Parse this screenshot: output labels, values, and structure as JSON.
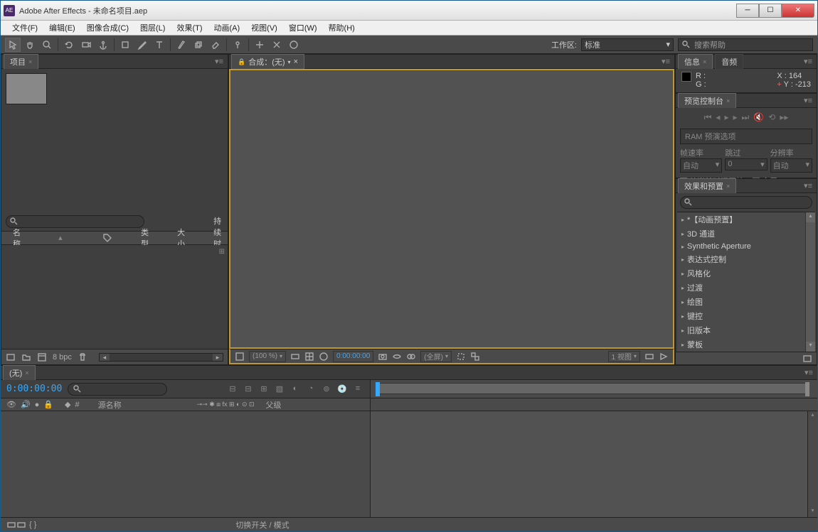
{
  "window": {
    "title": "Adobe After Effects - 未命名项目.aep",
    "icon": "AE"
  },
  "menu": [
    "文件(F)",
    "编辑(E)",
    "图像合成(C)",
    "图层(L)",
    "效果(T)",
    "动画(A)",
    "视图(V)",
    "窗口(W)",
    "帮助(H)"
  ],
  "toolbar": {
    "workspace_label": "工作区:",
    "workspace_value": "标准",
    "search_placeholder": "搜索帮助"
  },
  "project": {
    "tab_label": "项目",
    "columns": {
      "name": "名称",
      "type": "类型",
      "size": "大小",
      "duration": "持续时间"
    },
    "bpc": "8 bpc"
  },
  "comp": {
    "tab_label": "合成：(无)",
    "zoom": "(100 %)",
    "timecode": "0:00:00:00",
    "full": "(全屏)",
    "views": "1 视图"
  },
  "info": {
    "tab1": "信息",
    "tab2": "音频",
    "r": "R :",
    "g": "G :",
    "x_label": "X :",
    "x_val": "164",
    "y_label": "Y :",
    "y_val": "-213"
  },
  "preview": {
    "tab": "预览控制台",
    "ram": "RAM 预演选项",
    "fps_label": "帧速率",
    "skip_label": "跳过",
    "res_label": "分辨率",
    "fps_val": "自动",
    "skip_val": "0",
    "res_val": "自动",
    "chk_from": "从当前时间开始",
    "chk_full": "全屏"
  },
  "effects": {
    "tab": "效果和预置",
    "items": [
      "*【动画预置】",
      "3D 通道",
      "Synthetic Aperture",
      "表达式控制",
      "风格化",
      "过渡",
      "绘图",
      "键控",
      "旧版本",
      "蒙板"
    ]
  },
  "timeline": {
    "tab": "(无)",
    "timecode": "0:00:00:00",
    "src_label": "源名称",
    "parent_label": "父级",
    "switches": "切换开关 / 模式"
  }
}
